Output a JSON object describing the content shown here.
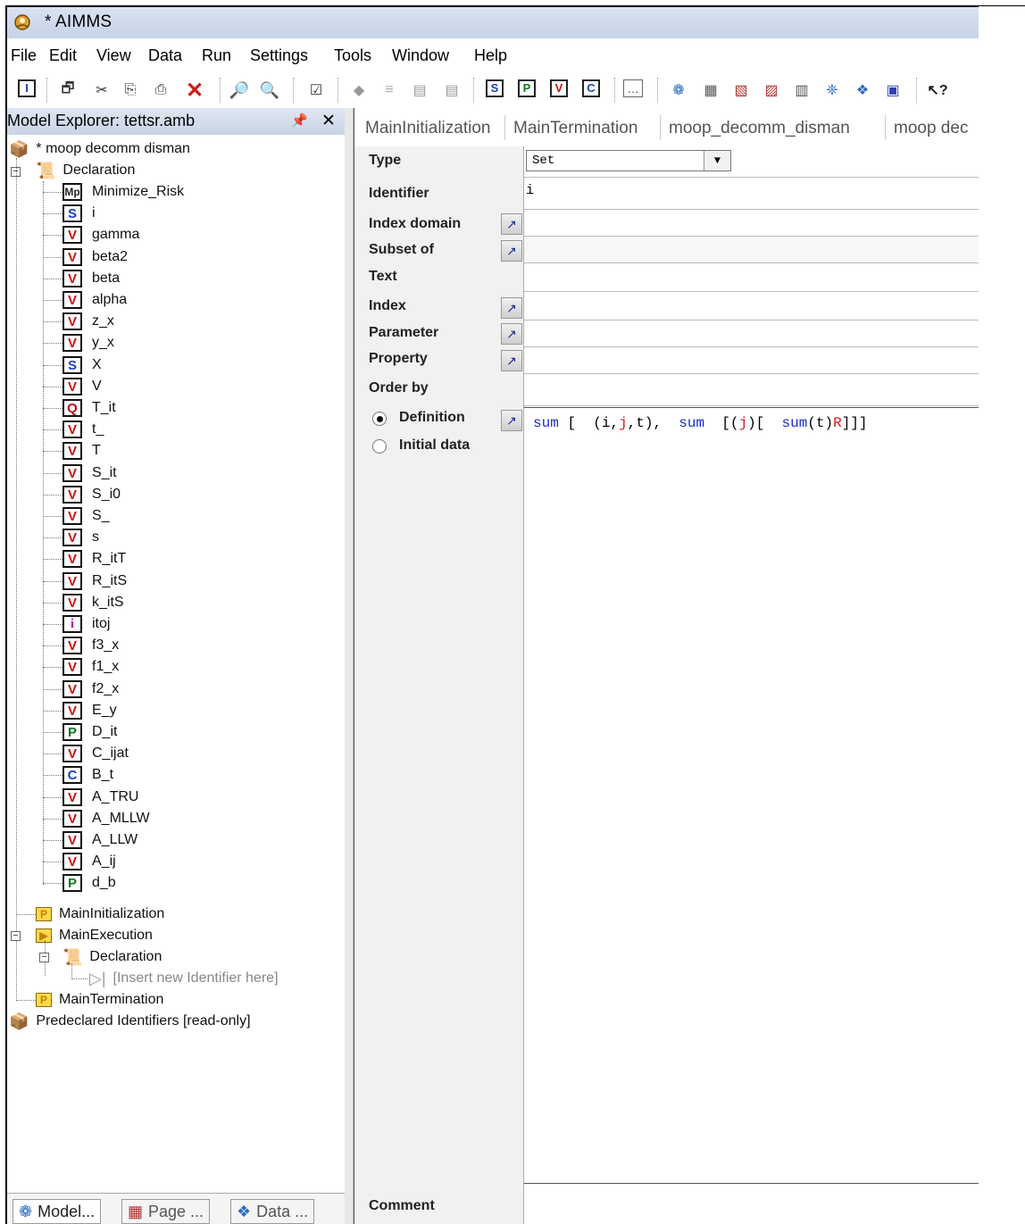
{
  "window": {
    "title": "* AIMMS"
  },
  "menu": [
    "File",
    "Edit",
    "View",
    "Data",
    "Run",
    "Settings",
    "Tools",
    "Window",
    "Help"
  ],
  "toolbar": {
    "icons": [
      "identifier-icon",
      "copy-window-icon",
      "cut-icon",
      "copy-icon",
      "paste-icon",
      "delete-icon",
      "find-icon",
      "find-next-icon",
      "properties-icon",
      "run-icon",
      "text-icon",
      "folder-icon",
      "folder2-icon",
      "new-set-button",
      "new-parameter-button",
      "new-variable-button",
      "new-constraint-button",
      "browse-button",
      "model-explorer-icon",
      "page-manager-icon",
      "template-icon",
      "menu-builder-icon",
      "identifier-selector-icon",
      "library-icon",
      "data-manager-icon",
      "info-icon",
      "help-icon"
    ],
    "box_labels": {
      "s": "S",
      "p": "P",
      "v": "V",
      "c": "C",
      "i": "I"
    }
  },
  "explorer": {
    "title": "Model Explorer: tettsr.amb",
    "pin": "ṕ",
    "close": "✕",
    "root": "* moop decomm disman",
    "declaration": "Declaration",
    "identifiers": [
      {
        "type": "Mp",
        "name": "Minimize_Risk"
      },
      {
        "type": "S",
        "name": "i"
      },
      {
        "type": "V",
        "name": "gamma"
      },
      {
        "type": "V",
        "name": "beta2"
      },
      {
        "type": "V",
        "name": "beta"
      },
      {
        "type": "V",
        "name": "alpha"
      },
      {
        "type": "V",
        "name": "z_x"
      },
      {
        "type": "V",
        "name": "y_x"
      },
      {
        "type": "S",
        "name": "X"
      },
      {
        "type": "V",
        "name": "V"
      },
      {
        "type": "Q",
        "name": "T_it"
      },
      {
        "type": "V",
        "name": "t_"
      },
      {
        "type": "V",
        "name": "T"
      },
      {
        "type": "V",
        "name": "S_it"
      },
      {
        "type": "V",
        "name": "S_i0"
      },
      {
        "type": "V",
        "name": "S_"
      },
      {
        "type": "V",
        "name": "s"
      },
      {
        "type": "V",
        "name": "R_itT"
      },
      {
        "type": "V",
        "name": "R_itS"
      },
      {
        "type": "V",
        "name": "k_itS"
      },
      {
        "type": "i",
        "name": "itoj"
      },
      {
        "type": "V",
        "name": "f3_x"
      },
      {
        "type": "V",
        "name": "f1_x"
      },
      {
        "type": "V",
        "name": "f2_x"
      },
      {
        "type": "V",
        "name": "E_y"
      },
      {
        "type": "P",
        "name": "D_it"
      },
      {
        "type": "V",
        "name": "C_ijat"
      },
      {
        "type": "C",
        "name": "B_t"
      },
      {
        "type": "V",
        "name": "A_TRU"
      },
      {
        "type": "V",
        "name": "A_MLLW"
      },
      {
        "type": "V",
        "name": "A_LLW"
      },
      {
        "type": "V",
        "name": "A_ij"
      },
      {
        "type": "P",
        "name": "d_b"
      }
    ],
    "main_init": "MainInitialization",
    "main_exec": "MainExecution",
    "exec_declaration": "Declaration",
    "insert_new": "[Insert new Identifier here]",
    "main_term": "MainTermination",
    "predeclared": "Predeclared Identifiers [read-only]"
  },
  "bottom_tabs": [
    "Model...",
    "Page ...",
    "Data ..."
  ],
  "editor": {
    "tabs": [
      "MainInitialization",
      "MainTermination",
      "moop_decomm_disman",
      "moop dec"
    ],
    "labels": {
      "type": "Type",
      "identifier": "Identifier",
      "index_domain": "Index domain",
      "subset_of": "Subset of",
      "text": "Text",
      "index": "Index",
      "parameter": "Parameter",
      "property": "Property",
      "order_by": "Order by",
      "definition": "Definition",
      "initial_data": "Initial data",
      "comment": "Comment"
    },
    "type_value": "Set",
    "identifier_value": "i",
    "definition": {
      "t1": "sum",
      "t2": " [  (i,",
      "t3": "j",
      "t4": ",t),  ",
      "t5": "sum",
      "t6": "  [(",
      "t7": "j",
      "t8": ")[  ",
      "t9": "sum",
      "t10": "(t)",
      "t11": "R",
      "t12": "]]]"
    }
  }
}
